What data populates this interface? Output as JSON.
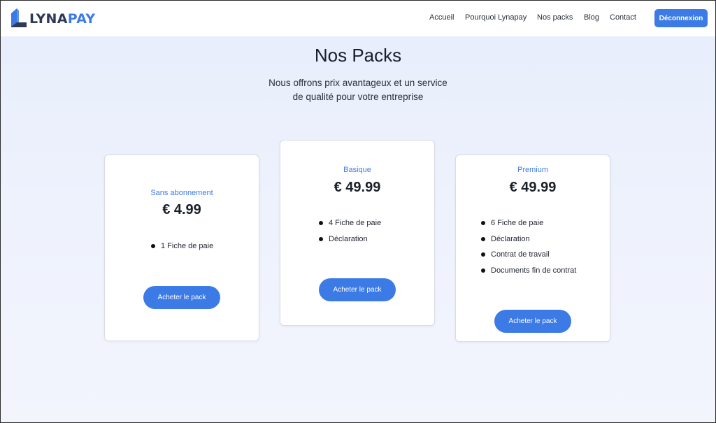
{
  "brand": {
    "name_part1": "LYNA",
    "name_part2": "PAY",
    "colors": {
      "primary": "#3c7be6",
      "dark": "#2e3a55"
    },
    "icon": "lynapay-logo-icon"
  },
  "nav": {
    "items": [
      {
        "label": "Accueil"
      },
      {
        "label": "Pourquoi Lynapay"
      },
      {
        "label": "Nos packs"
      },
      {
        "label": "Blog"
      },
      {
        "label": "Contact"
      }
    ],
    "logout_label": "Déconnexion"
  },
  "hero": {
    "title": "Nos Packs",
    "subtitle_line1": "Nous offrons prix avantageux et un service",
    "subtitle_line2": "de qualité pour votre entreprise"
  },
  "packs": [
    {
      "name": "Sans abonnement",
      "price": "€ 4.99",
      "features": [
        "1 Fiche de paie"
      ],
      "button": "Acheter le pack"
    },
    {
      "name": "Basique",
      "price": "€ 49.99",
      "features": [
        "4 Fiche de paie",
        "Déclaration"
      ],
      "button": "Acheter le pack"
    },
    {
      "name": "Premium",
      "price": "€ 49.99",
      "features": [
        "6 Fiche de paie",
        "Déclaration",
        "Contrat de travail",
        "Documents fin de contrat"
      ],
      "button": "Acheter le pack"
    }
  ]
}
